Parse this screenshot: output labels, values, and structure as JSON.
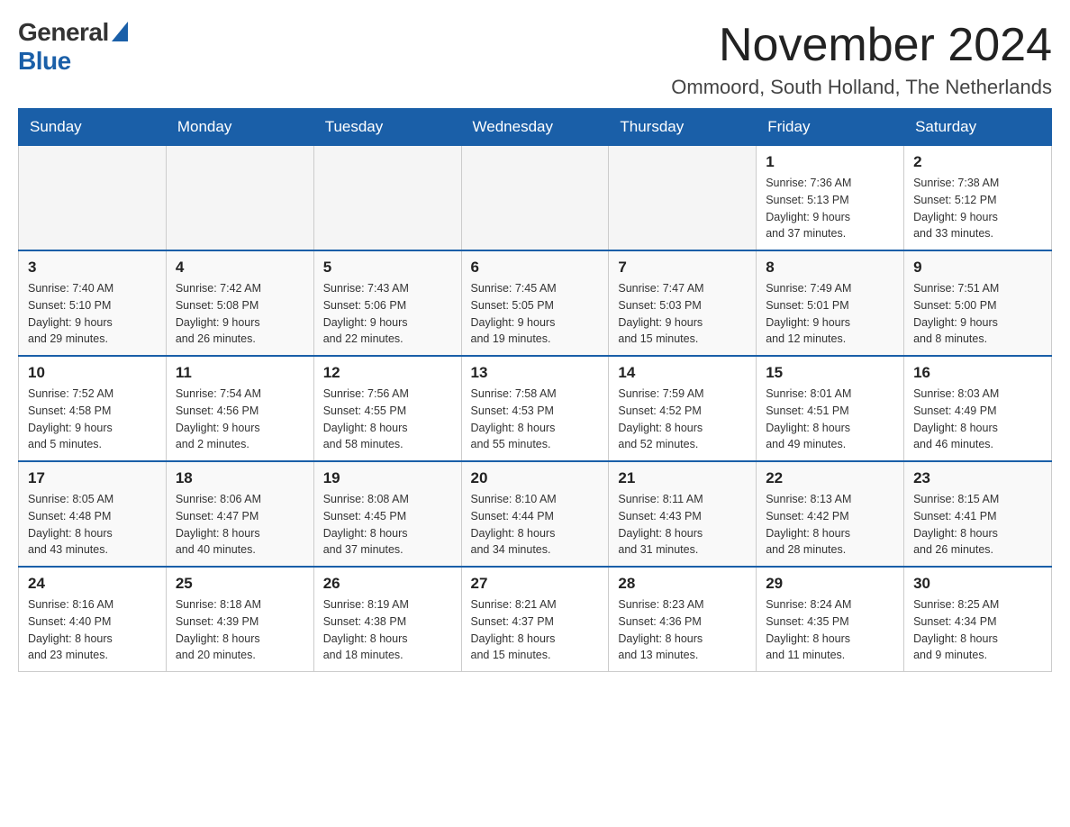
{
  "logo": {
    "general": "General",
    "blue": "Blue"
  },
  "header": {
    "title": "November 2024",
    "location": "Ommoord, South Holland, The Netherlands"
  },
  "days_of_week": [
    "Sunday",
    "Monday",
    "Tuesday",
    "Wednesday",
    "Thursday",
    "Friday",
    "Saturday"
  ],
  "weeks": [
    {
      "days": [
        {
          "number": "",
          "info": ""
        },
        {
          "number": "",
          "info": ""
        },
        {
          "number": "",
          "info": ""
        },
        {
          "number": "",
          "info": ""
        },
        {
          "number": "",
          "info": ""
        },
        {
          "number": "1",
          "info": "Sunrise: 7:36 AM\nSunset: 5:13 PM\nDaylight: 9 hours\nand 37 minutes."
        },
        {
          "number": "2",
          "info": "Sunrise: 7:38 AM\nSunset: 5:12 PM\nDaylight: 9 hours\nand 33 minutes."
        }
      ]
    },
    {
      "days": [
        {
          "number": "3",
          "info": "Sunrise: 7:40 AM\nSunset: 5:10 PM\nDaylight: 9 hours\nand 29 minutes."
        },
        {
          "number": "4",
          "info": "Sunrise: 7:42 AM\nSunset: 5:08 PM\nDaylight: 9 hours\nand 26 minutes."
        },
        {
          "number": "5",
          "info": "Sunrise: 7:43 AM\nSunset: 5:06 PM\nDaylight: 9 hours\nand 22 minutes."
        },
        {
          "number": "6",
          "info": "Sunrise: 7:45 AM\nSunset: 5:05 PM\nDaylight: 9 hours\nand 19 minutes."
        },
        {
          "number": "7",
          "info": "Sunrise: 7:47 AM\nSunset: 5:03 PM\nDaylight: 9 hours\nand 15 minutes."
        },
        {
          "number": "8",
          "info": "Sunrise: 7:49 AM\nSunset: 5:01 PM\nDaylight: 9 hours\nand 12 minutes."
        },
        {
          "number": "9",
          "info": "Sunrise: 7:51 AM\nSunset: 5:00 PM\nDaylight: 9 hours\nand 8 minutes."
        }
      ]
    },
    {
      "days": [
        {
          "number": "10",
          "info": "Sunrise: 7:52 AM\nSunset: 4:58 PM\nDaylight: 9 hours\nand 5 minutes."
        },
        {
          "number": "11",
          "info": "Sunrise: 7:54 AM\nSunset: 4:56 PM\nDaylight: 9 hours\nand 2 minutes."
        },
        {
          "number": "12",
          "info": "Sunrise: 7:56 AM\nSunset: 4:55 PM\nDaylight: 8 hours\nand 58 minutes."
        },
        {
          "number": "13",
          "info": "Sunrise: 7:58 AM\nSunset: 4:53 PM\nDaylight: 8 hours\nand 55 minutes."
        },
        {
          "number": "14",
          "info": "Sunrise: 7:59 AM\nSunset: 4:52 PM\nDaylight: 8 hours\nand 52 minutes."
        },
        {
          "number": "15",
          "info": "Sunrise: 8:01 AM\nSunset: 4:51 PM\nDaylight: 8 hours\nand 49 minutes."
        },
        {
          "number": "16",
          "info": "Sunrise: 8:03 AM\nSunset: 4:49 PM\nDaylight: 8 hours\nand 46 minutes."
        }
      ]
    },
    {
      "days": [
        {
          "number": "17",
          "info": "Sunrise: 8:05 AM\nSunset: 4:48 PM\nDaylight: 8 hours\nand 43 minutes."
        },
        {
          "number": "18",
          "info": "Sunrise: 8:06 AM\nSunset: 4:47 PM\nDaylight: 8 hours\nand 40 minutes."
        },
        {
          "number": "19",
          "info": "Sunrise: 8:08 AM\nSunset: 4:45 PM\nDaylight: 8 hours\nand 37 minutes."
        },
        {
          "number": "20",
          "info": "Sunrise: 8:10 AM\nSunset: 4:44 PM\nDaylight: 8 hours\nand 34 minutes."
        },
        {
          "number": "21",
          "info": "Sunrise: 8:11 AM\nSunset: 4:43 PM\nDaylight: 8 hours\nand 31 minutes."
        },
        {
          "number": "22",
          "info": "Sunrise: 8:13 AM\nSunset: 4:42 PM\nDaylight: 8 hours\nand 28 minutes."
        },
        {
          "number": "23",
          "info": "Sunrise: 8:15 AM\nSunset: 4:41 PM\nDaylight: 8 hours\nand 26 minutes."
        }
      ]
    },
    {
      "days": [
        {
          "number": "24",
          "info": "Sunrise: 8:16 AM\nSunset: 4:40 PM\nDaylight: 8 hours\nand 23 minutes."
        },
        {
          "number": "25",
          "info": "Sunrise: 8:18 AM\nSunset: 4:39 PM\nDaylight: 8 hours\nand 20 minutes."
        },
        {
          "number": "26",
          "info": "Sunrise: 8:19 AM\nSunset: 4:38 PM\nDaylight: 8 hours\nand 18 minutes."
        },
        {
          "number": "27",
          "info": "Sunrise: 8:21 AM\nSunset: 4:37 PM\nDaylight: 8 hours\nand 15 minutes."
        },
        {
          "number": "28",
          "info": "Sunrise: 8:23 AM\nSunset: 4:36 PM\nDaylight: 8 hours\nand 13 minutes."
        },
        {
          "number": "29",
          "info": "Sunrise: 8:24 AM\nSunset: 4:35 PM\nDaylight: 8 hours\nand 11 minutes."
        },
        {
          "number": "30",
          "info": "Sunrise: 8:25 AM\nSunset: 4:34 PM\nDaylight: 8 hours\nand 9 minutes."
        }
      ]
    }
  ]
}
